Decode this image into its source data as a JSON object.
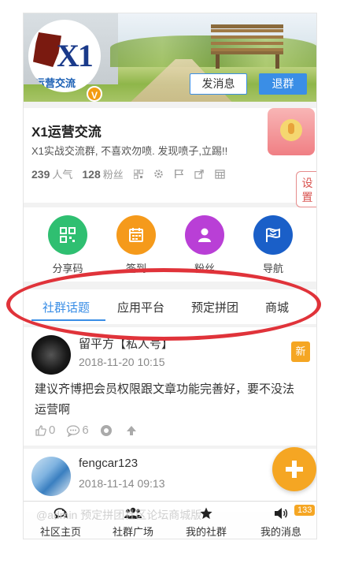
{
  "header": {
    "logo_text": "X1",
    "logo_subtitle": "运营交流",
    "vip_badge": "V",
    "post_button": "发消息",
    "quit_button": "退群"
  },
  "group": {
    "name": "X1运营交流",
    "description": "X1实战交流群, 不喜欢勿喷. 发现喷子,立踢!!",
    "popularity_value": "239",
    "popularity_label": "人气",
    "fans_value": "128",
    "fans_label": "粉丝",
    "settings_tab": "设置"
  },
  "grid": [
    {
      "label": "分享码",
      "color": "#2fbf71",
      "icon": "qrcode-icon"
    },
    {
      "label": "签到",
      "color": "#f59a1b",
      "icon": "calendar-icon"
    },
    {
      "label": "粉丝",
      "color": "#b93fd6",
      "icon": "user-icon"
    },
    {
      "label": "导航",
      "color": "#1a5fc8",
      "icon": "flag-icon"
    }
  ],
  "tabs": [
    "社群话题",
    "应用平台",
    "预定拼团",
    "商城"
  ],
  "posts": [
    {
      "author": "留平方【私人号】",
      "date": "2018-11-20 10:15",
      "badge": "新",
      "content": "建议齐博把会员权限跟文章功能完善好，要不没法运营啊",
      "likes": "0",
      "comments": "6"
    },
    {
      "author": "fengcar123",
      "date": "2018-11-14 09:13"
    }
  ],
  "watermark": "@admin 预定拼团社区论坛商城版",
  "bottom_nav": [
    {
      "label": "社区主页",
      "icon": "chat-icon"
    },
    {
      "label": "社群广场",
      "icon": "users-icon"
    },
    {
      "label": "我的社群",
      "icon": "star-icon"
    },
    {
      "label": "我的消息",
      "icon": "speaker-icon"
    }
  ],
  "message_count": "133",
  "colors": {
    "accent": "#3a8ee6",
    "badge_orange": "#f5a623",
    "annotation_red": "#e0333a"
  }
}
